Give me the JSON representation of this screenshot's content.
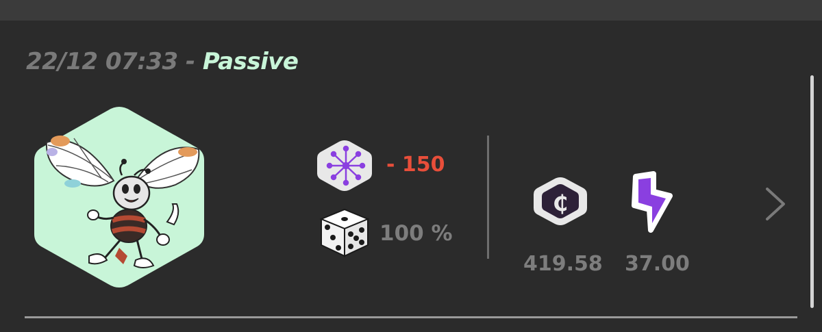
{
  "header": {
    "time": "22/12 07:33",
    "separator": " - ",
    "mode": "Passive"
  },
  "stats": {
    "energy_change": "- 150",
    "chance": "100 %",
    "coin_value": "419.58",
    "bolt_value": "37.00"
  },
  "colors": {
    "background": "#2b2b2b",
    "topbar": "#3b3b3b",
    "mode_accent": "#c8f5d8",
    "negative": "#e84e3a",
    "muted_text": "#7d7d7d",
    "purple": "#8a3fe0"
  },
  "icons": {
    "energy": "firework-burst-icon",
    "chance": "dice-icon",
    "coin": "crypto-coin-icon",
    "bolt": "lightning-bolt-icon",
    "next": "chevron-right-icon"
  }
}
